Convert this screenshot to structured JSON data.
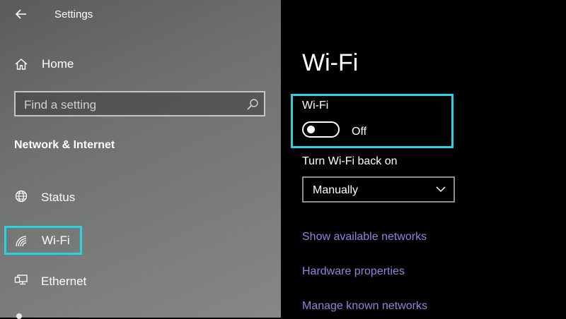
{
  "window": {
    "title": "Settings"
  },
  "sidebar": {
    "home_label": "Home",
    "search_placeholder": "Find a setting",
    "section_title": "Network & Internet",
    "items": [
      {
        "label": "Status",
        "icon": "globe-icon"
      },
      {
        "label": "Wi-Fi",
        "icon": "wifi-icon",
        "selected": true
      },
      {
        "label": "Ethernet",
        "icon": "ethernet-icon"
      }
    ]
  },
  "main": {
    "title": "Wi-Fi",
    "wifi_label": "Wi-Fi",
    "wifi_state": "Off",
    "wifi_on": false,
    "turn_back_label": "Turn Wi-Fi back on",
    "turn_back_value": "Manually",
    "links": [
      "Show available networks",
      "Hardware properties",
      "Manage known networks"
    ]
  },
  "colors": {
    "highlight": "#27d3e0",
    "link": "#8b88d9",
    "right_bg": "#000000",
    "left_bg": "#707271"
  }
}
